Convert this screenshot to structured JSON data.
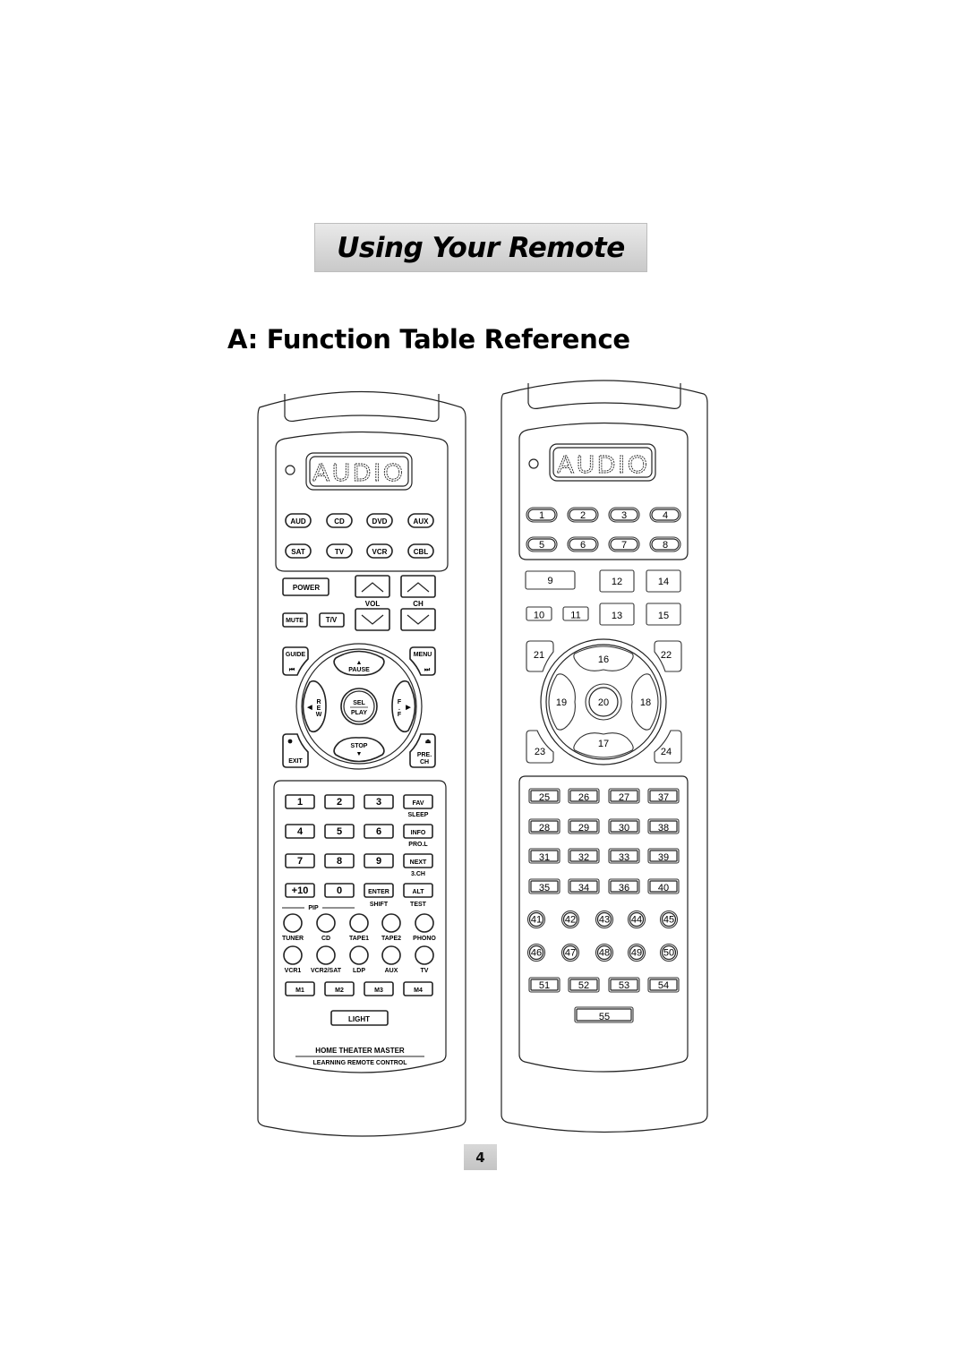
{
  "page": {
    "banner_title": "Using Your Remote",
    "section_title": "A: Function Table Reference",
    "page_number": "4"
  },
  "left_remote": {
    "display_text": "AUDIO",
    "source_buttons_row1": [
      "AUD",
      "CD",
      "DVD",
      "AUX"
    ],
    "source_buttons_row2": [
      "SAT",
      "TV",
      "VCR",
      "CBL"
    ],
    "power": "POWER",
    "mute": "MUTE",
    "tv_video": "T/V",
    "vol_label": "VOL",
    "ch_label": "CH",
    "guide": "GUIDE",
    "menu": "MENU",
    "exit": "EXIT",
    "prev_ch": [
      "PRE.",
      "CH"
    ],
    "pause": "PAUSE",
    "stop": "STOP",
    "rew": [
      "R",
      "E",
      "W"
    ],
    "ff": [
      "F",
      ".",
      "F"
    ],
    "sel": "SEL",
    "play": "PLAY",
    "keypad": [
      {
        "keys": [
          "1",
          "2",
          "3",
          "FAV"
        ],
        "sub": "SLEEP"
      },
      {
        "keys": [
          "4",
          "5",
          "6",
          "INFO"
        ],
        "sub": "PRO.L"
      },
      {
        "keys": [
          "7",
          "8",
          "9",
          "NEXT"
        ],
        "sub": "3.CH"
      },
      {
        "keys": [
          "+10",
          "0",
          "ENTER",
          "ALT"
        ],
        "sub": ""
      }
    ],
    "pip_label": "PIP",
    "shift_label": "SHIFT",
    "test_label": "TEST",
    "round_row1": [
      "TUNER",
      "CD",
      "TAPE1",
      "TAPE2",
      "PHONO"
    ],
    "round_row2": [
      "VCR1",
      "VCR2/SAT",
      "LDP",
      "AUX",
      "TV"
    ],
    "macros": [
      "M1",
      "M2",
      "M3",
      "M4"
    ],
    "light": "LIGHT",
    "brand": "HOME THEATER MASTER",
    "subbrand": "LEARNING REMOTE CONTROL"
  },
  "right_remote": {
    "display_text": "AUDIO",
    "pill_row1": [
      "1",
      "2",
      "3",
      "4"
    ],
    "pill_row2": [
      "5",
      "6",
      "7",
      "8"
    ],
    "box_row1": [
      "9",
      "12",
      "14"
    ],
    "box_row2": [
      "10",
      "11",
      "13",
      "15"
    ],
    "nav": {
      "tl": "21",
      "tr": "22",
      "up": "16",
      "left": "19",
      "center": "20",
      "right": "18",
      "down": "17",
      "bl": "23",
      "br": "24"
    },
    "grid": [
      [
        "25",
        "26",
        "27",
        "37"
      ],
      [
        "28",
        "29",
        "30",
        "38"
      ],
      [
        "31",
        "32",
        "33",
        "39"
      ],
      [
        "35",
        "34",
        "36",
        "40"
      ]
    ],
    "circles_row1": [
      "41",
      "42",
      "43",
      "44",
      "45"
    ],
    "circles_row2": [
      "46",
      "47",
      "48",
      "49",
      "50"
    ],
    "bottom_row": [
      "51",
      "52",
      "53",
      "54"
    ],
    "wide": "55"
  }
}
